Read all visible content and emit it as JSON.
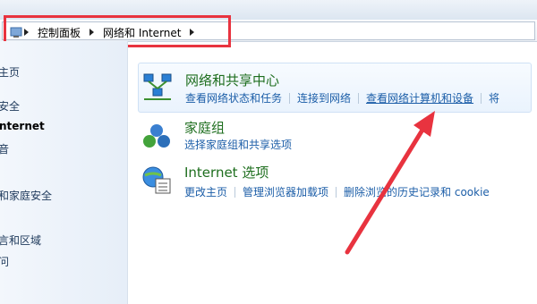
{
  "breadcrumb": [
    "控制面板",
    "网络和 Internet"
  ],
  "left_nav": {
    "items": [
      "主页",
      "安全",
      "nternet",
      "音",
      "和家庭安全",
      "言和区域",
      "问"
    ]
  },
  "categories": [
    {
      "title": "网络和共享中心",
      "links": [
        "查看网络状态和任务",
        "连接到网络",
        "查看网络计算机和设备",
        "将"
      ]
    },
    {
      "title": "家庭组",
      "links": [
        "选择家庭组和共享选项"
      ]
    },
    {
      "title": "Internet 选项",
      "links": [
        "更改主页",
        "管理浏览器加载项",
        "删除浏览的历史记录和 cookie"
      ]
    }
  ],
  "colors": {
    "highlight_red": "#e8333f",
    "link_blue": "#1c5ea8",
    "title_green": "#1e6e1e"
  },
  "icons": [
    "network-sharing-center-icon",
    "homegroup-icon",
    "internet-options-icon"
  ]
}
